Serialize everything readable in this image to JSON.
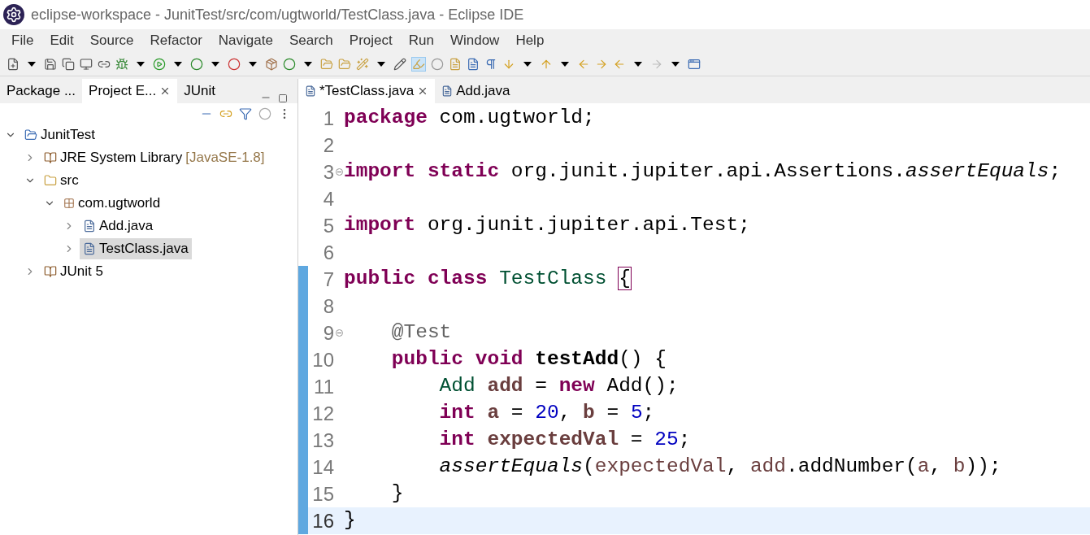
{
  "window": {
    "title": "eclipse-workspace - JunitTest/src/com/ugtworld/TestClass.java - Eclipse IDE"
  },
  "menu": [
    "File",
    "Edit",
    "Source",
    "Refactor",
    "Navigate",
    "Search",
    "Project",
    "Run",
    "Window",
    "Help"
  ],
  "left_tabs": [
    {
      "label": "Package ...",
      "selected": false,
      "closable": false
    },
    {
      "label": "Project E...",
      "selected": true,
      "closable": true
    },
    {
      "label": "JUnit",
      "selected": false,
      "closable": false
    }
  ],
  "tree": [
    {
      "label": "JunitTest",
      "kind": "project",
      "expanded": true,
      "selected": false,
      "children": [
        {
          "label": "JRE System Library",
          "decoration": "[JavaSE-1.8]",
          "kind": "library",
          "expanded": false,
          "selected": false
        },
        {
          "label": "src",
          "kind": "folder",
          "expanded": true,
          "selected": false,
          "children": [
            {
              "label": "com.ugtworld",
              "kind": "package",
              "expanded": true,
              "selected": false,
              "children": [
                {
                  "label": "Add.java",
                  "kind": "file",
                  "expanded": false,
                  "selected": false
                },
                {
                  "label": "TestClass.java",
                  "kind": "file",
                  "expanded": false,
                  "selected": true
                }
              ]
            }
          ]
        },
        {
          "label": "JUnit 5",
          "kind": "library",
          "expanded": false,
          "selected": false
        }
      ]
    }
  ],
  "editor_tabs": [
    {
      "label": "*TestClass.java",
      "selected": true,
      "closable": true
    },
    {
      "label": "Add.java",
      "selected": false,
      "closable": false
    }
  ],
  "code": [
    {
      "number": "1",
      "fold": false,
      "changed": false,
      "current": false,
      "tokens": [
        {
          "t": "package",
          "kind": "kw"
        },
        {
          "t": " com.ugtworld;",
          "kind": "plain"
        }
      ]
    },
    {
      "number": "2",
      "fold": false,
      "changed": false,
      "current": false
    },
    {
      "number": "3",
      "fold": true,
      "changed": false,
      "current": false,
      "tokens": [
        {
          "t": "import",
          "kind": "kw"
        },
        {
          "t": " static",
          "kind": "kw"
        },
        {
          "t": " org.junit.jupiter.api.Assertions.",
          "kind": "plain"
        },
        {
          "t": "assertEquals",
          "kind": "static"
        },
        {
          "t": ";",
          "kind": "plain"
        }
      ]
    },
    {
      "number": "4",
      "fold": false,
      "changed": false,
      "current": false
    },
    {
      "number": "5",
      "fold": false,
      "changed": false,
      "current": false,
      "tokens": [
        {
          "t": "import",
          "kind": "kw"
        },
        {
          "t": " org.junit.jupiter.api.Test;",
          "kind": "plain"
        }
      ]
    },
    {
      "number": "6",
      "fold": false,
      "changed": false,
      "current": false
    },
    {
      "number": "7",
      "fold": false,
      "changed": true,
      "current": false,
      "tokens": [
        {
          "t": "public",
          "kind": "kw"
        },
        {
          "t": " class",
          "kind": "kw"
        },
        {
          "t": " TestClass ",
          "kind": "type"
        },
        {
          "t": "{",
          "kind": "bracket"
        }
      ]
    },
    {
      "number": "8",
      "fold": false,
      "changed": true,
      "current": false
    },
    {
      "number": "9",
      "fold": true,
      "changed": true,
      "current": false,
      "tokens": [
        {
          "t": "    @Test",
          "kind": "annotation"
        }
      ]
    },
    {
      "number": "10",
      "fold": false,
      "changed": true,
      "current": false,
      "tokens": [
        {
          "t": "    public",
          "kind": "kw"
        },
        {
          "t": " void",
          "kind": "kw"
        },
        {
          "t": " testAdd",
          "kind": "method"
        },
        {
          "t": "() {",
          "kind": "plain"
        }
      ]
    },
    {
      "number": "11",
      "fold": false,
      "changed": true,
      "current": false,
      "tokens": [
        {
          "t": "        Add",
          "kind": "type"
        },
        {
          "t": " add",
          "kind": "vardecl"
        },
        {
          "t": " = ",
          "kind": "plain"
        },
        {
          "t": "new",
          "kind": "kw"
        },
        {
          "t": " Add();",
          "kind": "plain"
        }
      ]
    },
    {
      "number": "12",
      "fold": false,
      "changed": true,
      "current": false,
      "tokens": [
        {
          "t": "        int",
          "kind": "kw"
        },
        {
          "t": " a",
          "kind": "vardecl"
        },
        {
          "t": " = ",
          "kind": "plain"
        },
        {
          "t": "20",
          "kind": "num"
        },
        {
          "t": ", ",
          "kind": "plain"
        },
        {
          "t": "b",
          "kind": "vardecl"
        },
        {
          "t": " = ",
          "kind": "plain"
        },
        {
          "t": "5",
          "kind": "num"
        },
        {
          "t": ";",
          "kind": "plain"
        }
      ]
    },
    {
      "number": "13",
      "fold": false,
      "changed": true,
      "current": false,
      "tokens": [
        {
          "t": "        int",
          "kind": "kw"
        },
        {
          "t": " expectedVal",
          "kind": "vardecl"
        },
        {
          "t": " = ",
          "kind": "plain"
        },
        {
          "t": "25",
          "kind": "num"
        },
        {
          "t": ";",
          "kind": "plain"
        }
      ]
    },
    {
      "number": "14",
      "fold": false,
      "changed": true,
      "current": false,
      "tokens": [
        {
          "t": "        assertEquals",
          "kind": "static"
        },
        {
          "t": "(",
          "kind": "plain"
        },
        {
          "t": "expectedVal",
          "kind": "var"
        },
        {
          "t": ", ",
          "kind": "plain"
        },
        {
          "t": "add",
          "kind": "var"
        },
        {
          "t": ".addNumber(",
          "kind": "plain"
        },
        {
          "t": "a",
          "kind": "var"
        },
        {
          "t": ", ",
          "kind": "plain"
        },
        {
          "t": "b",
          "kind": "var"
        },
        {
          "t": "));",
          "kind": "plain"
        }
      ]
    },
    {
      "number": "15",
      "fold": false,
      "changed": true,
      "current": false,
      "tokens": [
        {
          "t": "    }",
          "kind": "plain"
        }
      ]
    },
    {
      "number": "16",
      "fold": false,
      "changed": true,
      "current": true,
      "tokens": [
        {
          "t": "}",
          "kind": "plain"
        }
      ]
    }
  ]
}
